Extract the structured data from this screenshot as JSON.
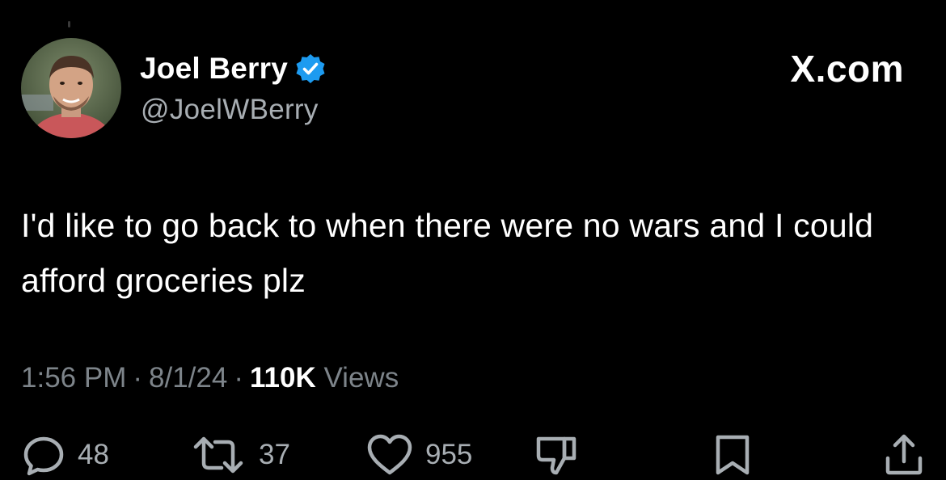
{
  "author": {
    "display_name": "Joel Berry",
    "handle": "@JoelWBerry",
    "verified": true
  },
  "brand": "X.com",
  "tweet": {
    "text": "I'd like to go back to when there were no wars and I could afford groceries plz",
    "time": "1:56 PM",
    "date": "8/1/24",
    "views_count": "110K",
    "views_label": "Views"
  },
  "actions": {
    "replies": "48",
    "reposts": "37",
    "likes": "955"
  },
  "colors": {
    "background": "#000000",
    "text": "#ffffff",
    "muted": "#7d848a",
    "verified_badge": "#1d9bf0"
  },
  "icons": [
    "reply-icon",
    "repost-icon",
    "like-icon",
    "dislike-icon",
    "bookmark-icon",
    "share-icon"
  ]
}
